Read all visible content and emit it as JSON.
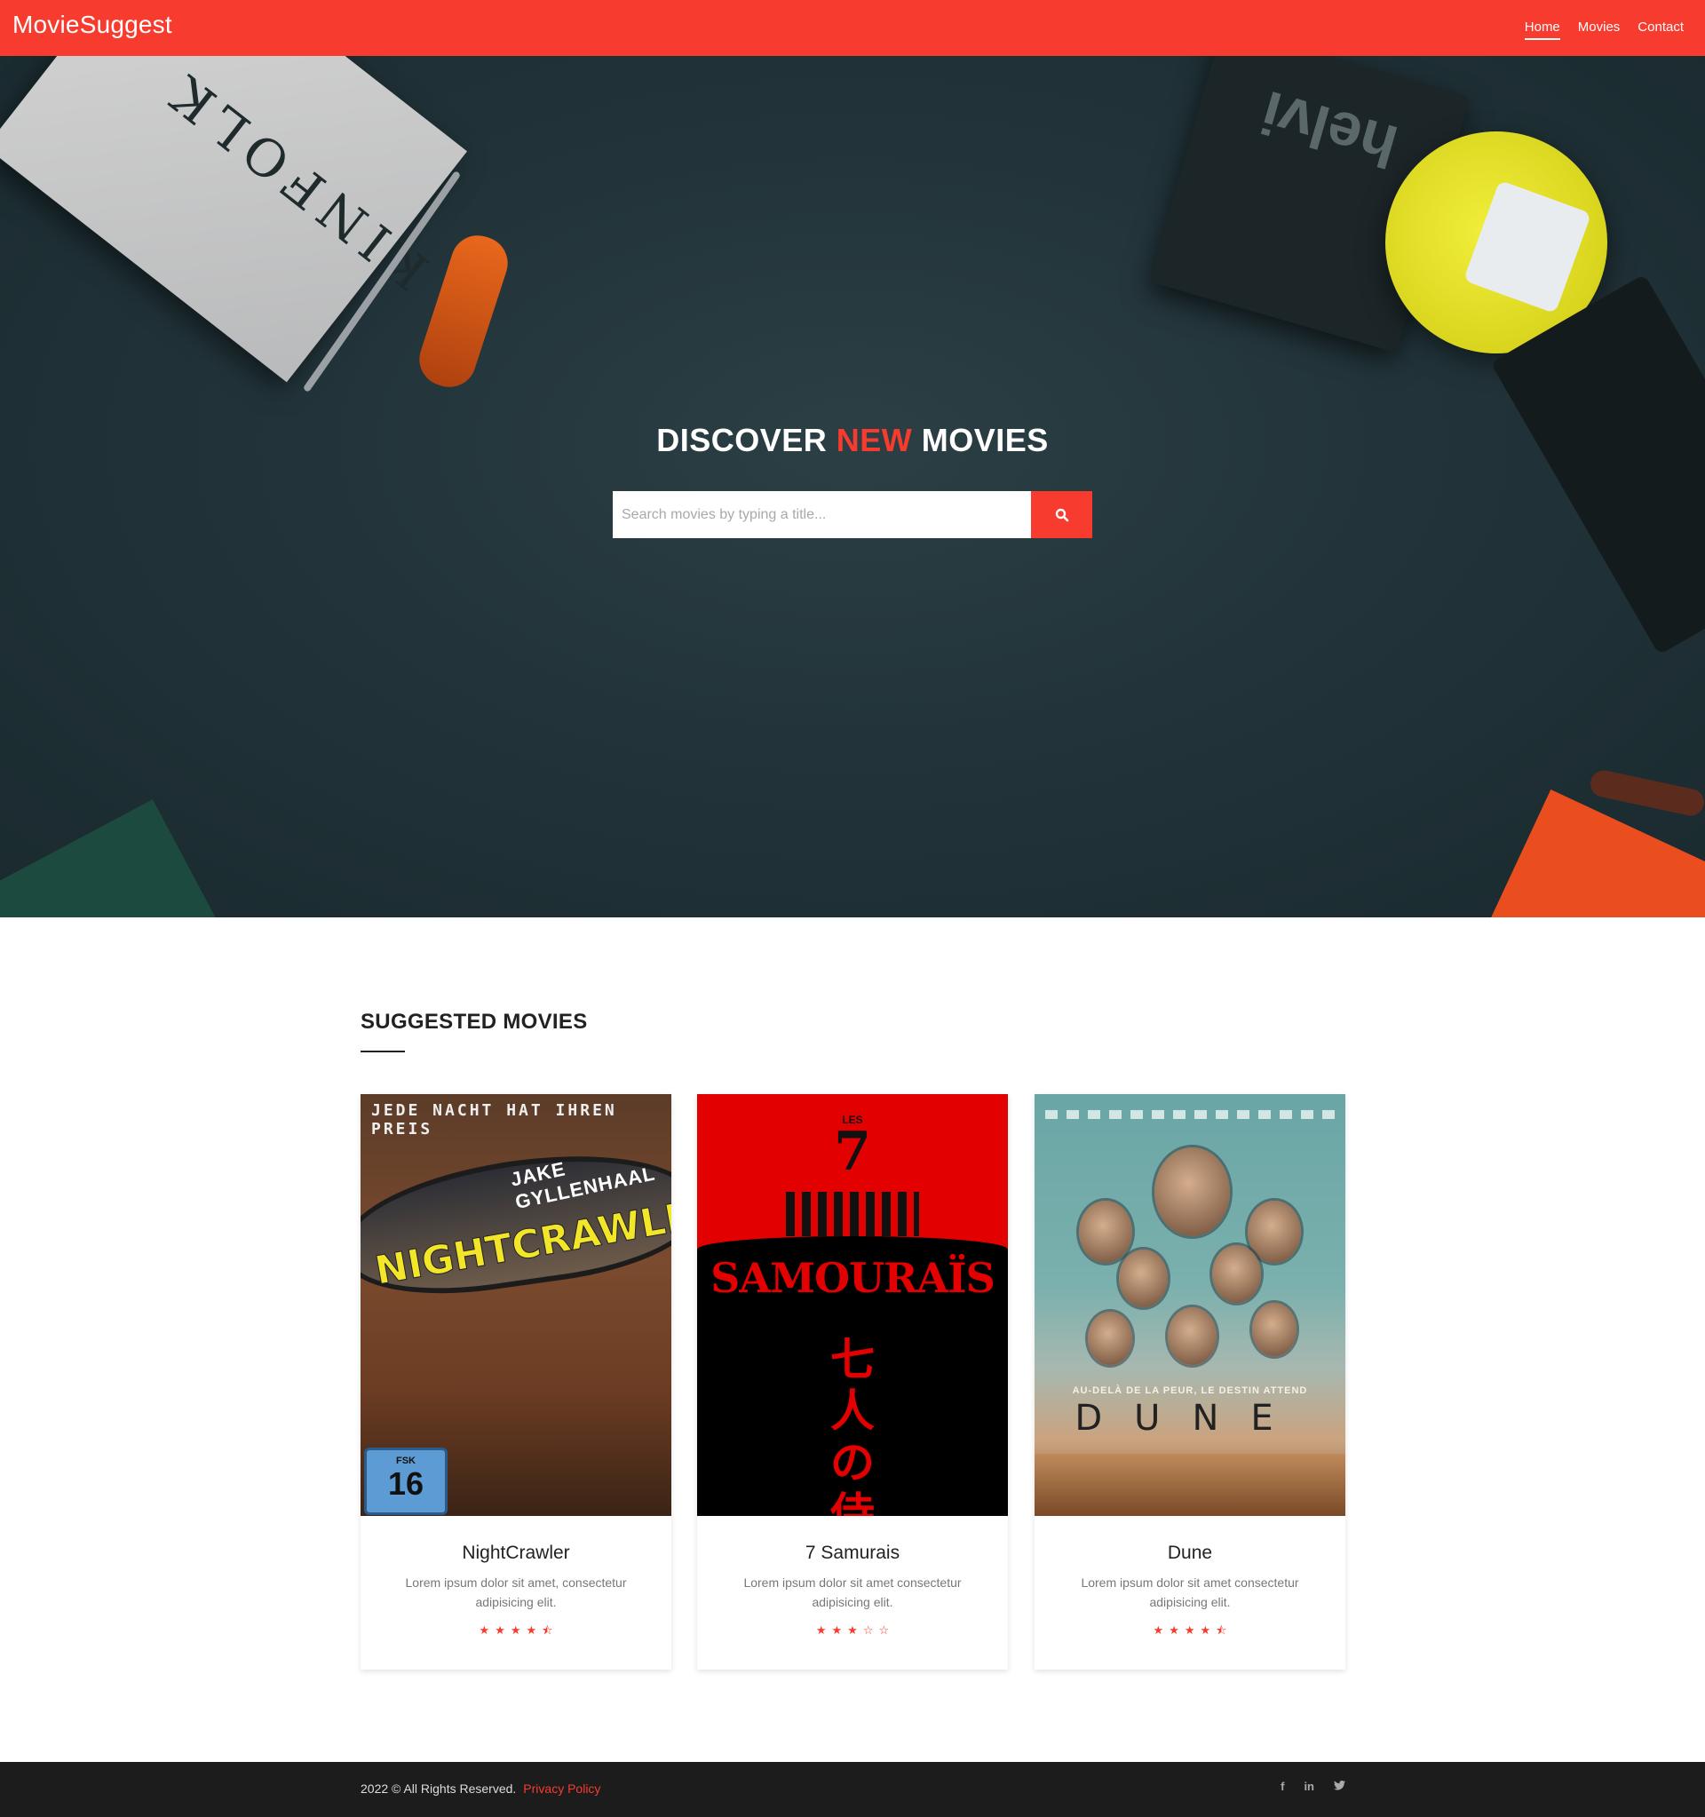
{
  "navbar": {
    "brand": "MovieSuggest",
    "links": [
      {
        "label": "Home",
        "active": true
      },
      {
        "label": "Movies",
        "active": false
      },
      {
        "label": "Contact",
        "active": false
      }
    ]
  },
  "hero": {
    "title_part1": "DISCOVER ",
    "title_accent": "NEW",
    "title_part2": " MOVIES",
    "search_placeholder": "Search movies by typing a title...",
    "search_button_icon": "search-icon",
    "background_props": {
      "book_text": "KINFOLK",
      "notebook_text": "helvi"
    }
  },
  "suggested": {
    "heading": "SUGGESTED MOVIES",
    "movies": [
      {
        "title": "NightCrawler",
        "description": "Lorem ipsum dolor sit amet, consectetur adipisicing elit.",
        "rating": 4.5,
        "poster": {
          "tagline": "JEDE NACHT HAT IHREN PREIS",
          "actor": "JAKE GYLLENHAAL",
          "title": "NIGHTCRAWLER",
          "badge_top": "FSK",
          "badge_number": "16"
        }
      },
      {
        "title": "7 Samurais",
        "description": "Lorem ipsum dolor sit amet consectetur adipisicing elit.",
        "rating": 3,
        "poster": {
          "small": "LES",
          "number": "7",
          "title": "SAMOURAÏS",
          "kanji": "七人の侍"
        }
      },
      {
        "title": "Dune",
        "description": "Lorem ipsum dolor sit amet consectetur adipisicing elit.",
        "rating": 4.5,
        "poster": {
          "tagline": "AU-DELÀ DE LA PEUR, LE DESTIN ATTEND",
          "title": "DUNE"
        }
      }
    ]
  },
  "footer": {
    "copyright": "2022 © All Rights Reserved.",
    "privacy": "Privacy Policy",
    "socials": [
      {
        "icon": "facebook-icon",
        "glyph": "f"
      },
      {
        "icon": "linkedin-icon",
        "glyph": "in"
      },
      {
        "icon": "twitter-icon",
        "glyph": "t"
      }
    ]
  },
  "colors": {
    "accent": "#f73b2e",
    "footer_bg": "#1c1c1c",
    "hero_bg": "#22343a"
  }
}
